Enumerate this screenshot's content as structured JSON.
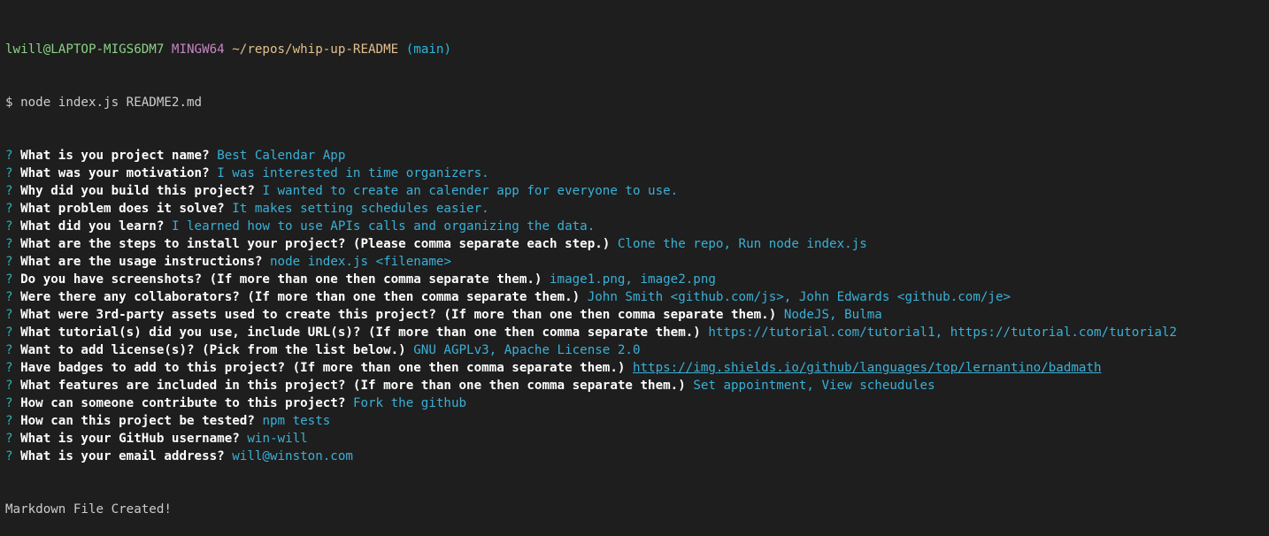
{
  "prompt": {
    "user_host": "lwill@LAPTOP-MIGS6DM7",
    "system": "MINGW64",
    "path": "~/repos/whip-up-README",
    "branch": "(main)",
    "symbol": "$",
    "command": "node index.js README2.md"
  },
  "qmark": "?",
  "qa": [
    {
      "q": "What is you project name?",
      "a": "Best Calendar App"
    },
    {
      "q": "What was your motivation?",
      "a": "I was interested in time organizers."
    },
    {
      "q": "Why did you build this project?",
      "a": "I wanted to create an calender app for everyone to use."
    },
    {
      "q": "What problem does it solve?",
      "a": "It makes setting schedules easier."
    },
    {
      "q": "What did you learn?",
      "a": "I learned how to use APIs calls and organizing the data."
    },
    {
      "q": "What are the steps to install your project? (Please comma separate each step.)",
      "a": "Clone the repo, Run node index.js"
    },
    {
      "q": "What are the usage instructions?",
      "a": "node index.js <filename>"
    },
    {
      "q": "Do you have screenshots? (If more than one then comma separate them.)",
      "a": "image1.png, image2.png"
    },
    {
      "q": "Were there any collaborators? (If more than one then comma separate them.)",
      "a": "John Smith <github.com/js>, John Edwards <github.com/je>"
    },
    {
      "q": "What were 3rd-party assets used to create this project? (If more than one then comma separate them.)",
      "a": "NodeJS, Bulma"
    },
    {
      "q": "What tutorial(s) did you use, include URL(s)? (If more than one then comma separate them.)",
      "a": "https://tutorial.com/tutorial1, https://tutorial.com/tutorial2"
    },
    {
      "q": "Want to add license(s)? (Pick from the list below.)",
      "a": "GNU AGPLv3, Apache License 2.0"
    },
    {
      "q": "Have badges to add to this project? (If more than one then comma separate them.)",
      "a": "https://img.shields.io/github/languages/top/lernantino/badmath",
      "link": true
    },
    {
      "q": "What features are included in this project? (If more than one then comma separate them.)",
      "a": "Set appointment, View scheudules"
    },
    {
      "q": "How can someone contribute to this project?",
      "a": "Fork the github"
    },
    {
      "q": "How can this project be tested?",
      "a": "npm tests"
    },
    {
      "q": "What is your GitHub username?",
      "a": "win-will"
    },
    {
      "q": "What is your email address?",
      "a": "will@winston.com"
    }
  ],
  "final_message": "Markdown File Created!",
  "colors": {
    "background": "#1e1e1e",
    "question": "#ffffff",
    "answer": "#3ab0d6",
    "qmark": "#2bb3b3",
    "user_host": "#89d185",
    "system": "#c586c0",
    "path": "#e2c08d",
    "branch": "#29b8db"
  }
}
